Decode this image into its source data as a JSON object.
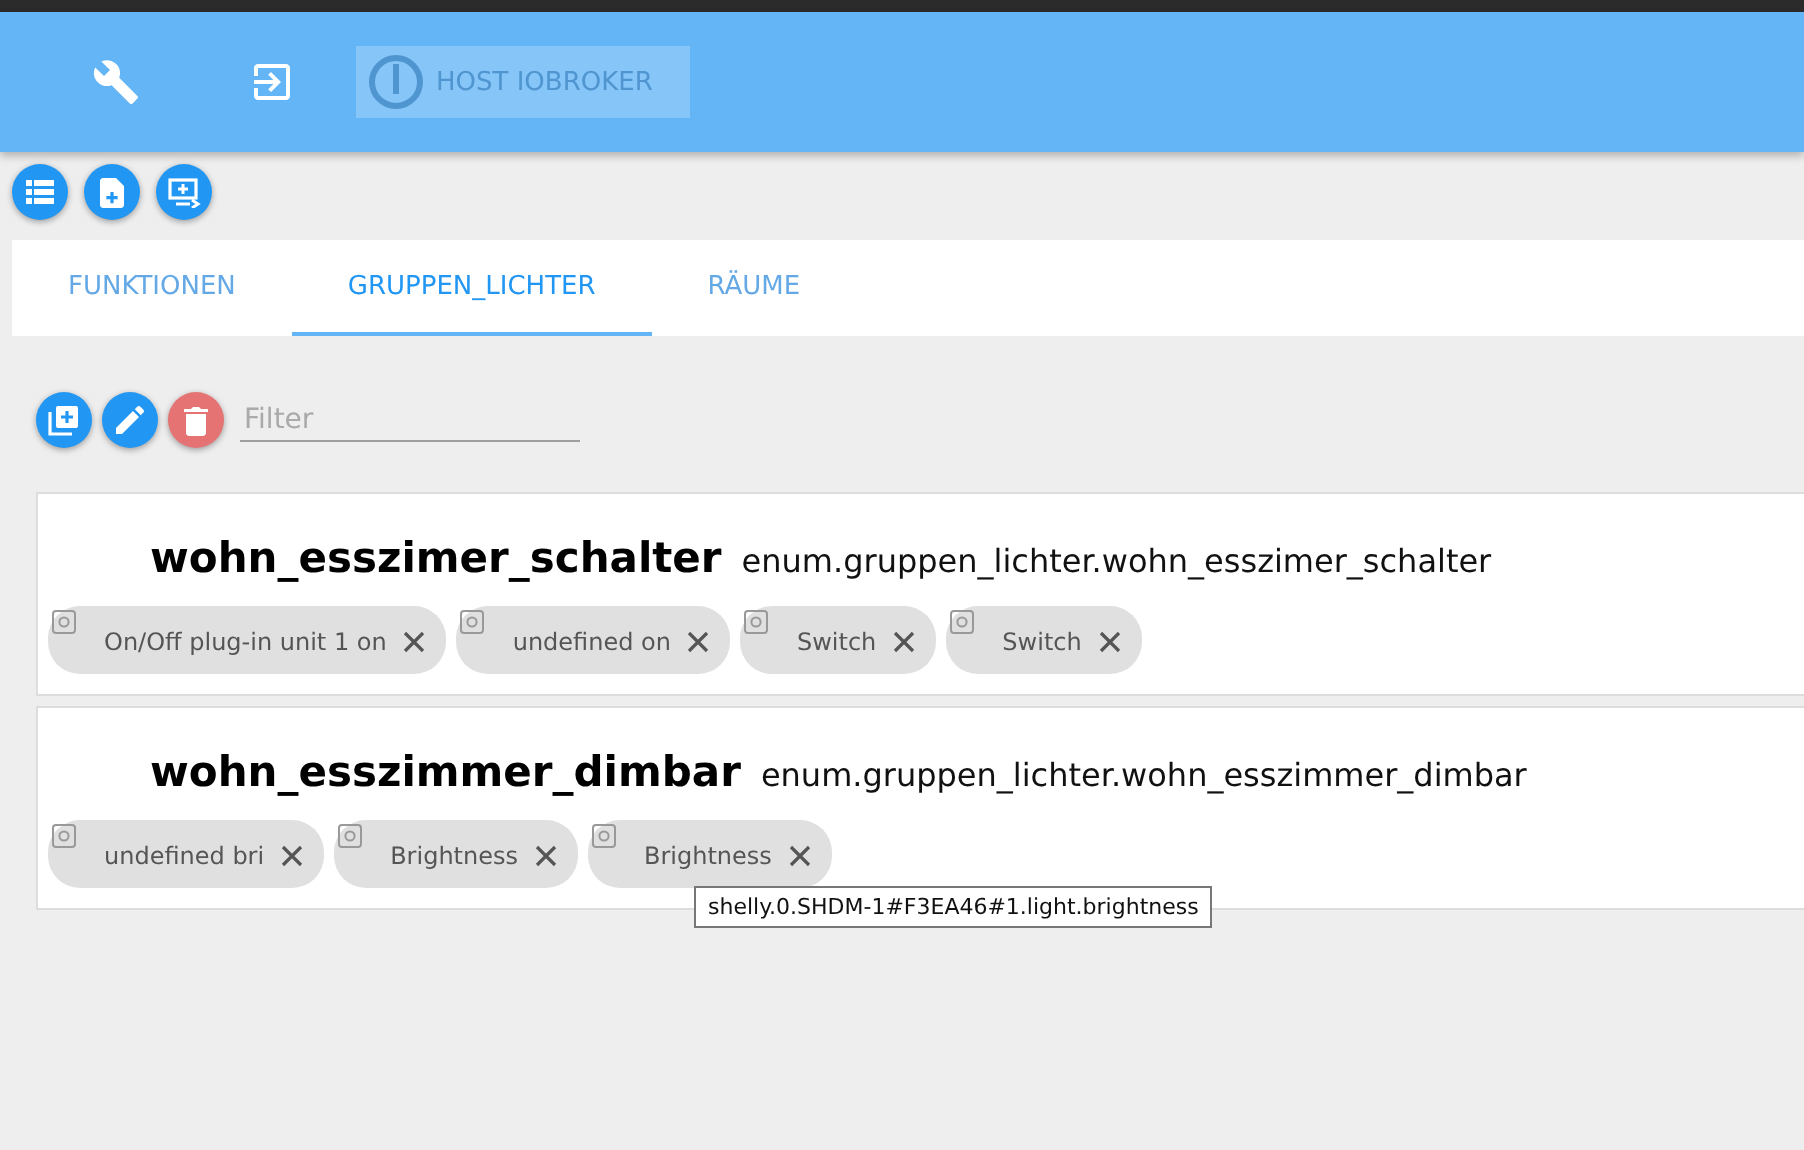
{
  "header": {
    "logo_text": "HOST IOBROKER"
  },
  "tabs": [
    {
      "label": "FUNKTIONEN",
      "selected": false
    },
    {
      "label": "GRUPPEN_LICHTER",
      "selected": true
    },
    {
      "label": "RÄUME",
      "selected": false
    }
  ],
  "filter": {
    "placeholder": "Filter"
  },
  "groups": [
    {
      "name": "wohn_esszimer_schalter",
      "id": "enum.gruppen_lichter.wohn_esszimer_schalter",
      "members": [
        "On/Off plug-in unit 1 on",
        "undefined on",
        "Switch",
        "Switch"
      ]
    },
    {
      "name": "wohn_esszimmer_dimbar",
      "id": "enum.gruppen_lichter.wohn_esszimmer_dimbar",
      "members": [
        "undefined bri",
        "Brightness",
        "Brightness"
      ]
    }
  ],
  "tooltip": "shelly.0.SHDM-1#F3EA46#1.light.brightness"
}
